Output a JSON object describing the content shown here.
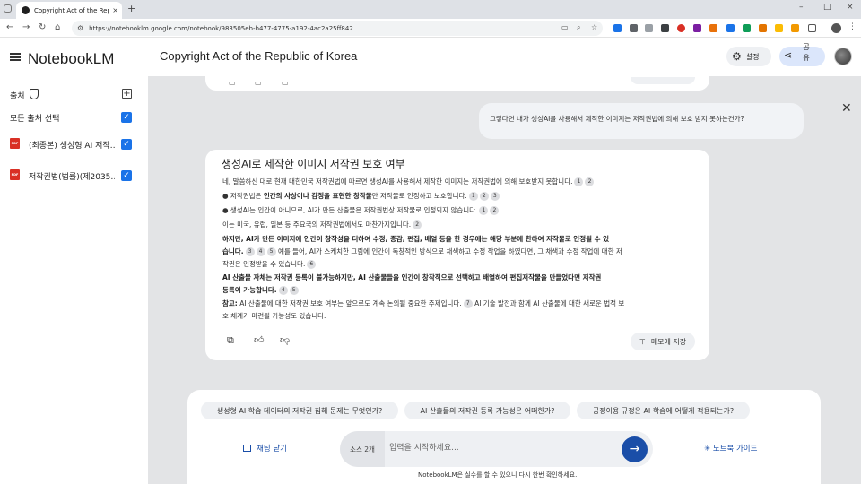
{
  "browser": {
    "tab_title": "Copyright Act of the Republic",
    "tab_close": "×",
    "new_tab": "+",
    "url": "https://notebooklm.google.com/notebook/983505eb-b477-4775-a192-4ac2a25ff842",
    "window_controls": [
      "–",
      "□",
      "×"
    ]
  },
  "header": {
    "brand": "NotebookLM",
    "notebook_title": "Copyright Act of the Republic of Korea",
    "settings_label": "설정",
    "share_label": "공유"
  },
  "sidebar": {
    "sources_heading": "출처",
    "select_all_label": "모든 출처 선택",
    "sources": [
      {
        "label": "(최종본) 생성형 AI 저작…",
        "type_badge": "PDF",
        "checked": true
      },
      {
        "label": "저작권법(법률)(제2035…",
        "type_badge": "PDF",
        "checked": true
      }
    ]
  },
  "chat": {
    "user_question": "그렇다면 내가 생성AI를 사용해서 제작한 이미지는 저작권법에 의해 보호 받지 못하는건가?",
    "answer_title": "생성AI로 제작한 이미지 저작권 보호 여부",
    "answer": {
      "p1": "네, 말씀하신 대로 현재 대한민국 저작권법에 따르면 생성AI를 사용해서 제작한 이미지는 저작권법에 의해 보호받지 못합니다.",
      "b1_pre": "● 저작권법은 ",
      "b1_bold": "인간의 사상이나 감정을 표현한 창작물",
      "b1_post": "만 저작물로 인정하고 보호합니다.",
      "b2": "● 생성AI는 인간이 아니므로, AI가 만든 산출물은 저작권법상 저작물로 인정되지 않습니다.",
      "p2": "이는 미국, 유럽, 일본 등 주요국의 저작권법에서도 마찬가지입니다.",
      "p3_l1": "하지만, AI가 만든 이미지에 인간이 창작성을 더하여 수정, 증감, 편집, 배열 등을 한 경우에는 해당 부분에 한하여 저작물로 인정될 수 있",
      "p3_l2": "습니다.",
      "p3_l2_rest": "예를 들어, AI가 스케치한 그림에 인간이 독창적인 방식으로 채색하고 수정 작업을 하였다면, 그 채색과 수정 작업에 대한 저",
      "p3_l3": "작권은 인정받을 수 있습니다.",
      "p4_l1": "AI 산출물 자체는 저작권 등록이 불가능하지만, AI 산출물들을 인간이 창작적으로 선택하고 배열하여 편집저작물을 만들었다면 저작권",
      "p4_l2": "등록이 가능합니다.",
      "p5_label": "참고:",
      "p5_l1": "AI 산출물에 대한 저작권 보호 여부는 앞으로도 계속 논의될 중요한 주제입니다.",
      "p5_l1_rest": "AI 기술 발전과 함께 AI 산출물에 대한 새로운 법적 보",
      "p5_l2": "호 체계가 마련될 가능성도 있습니다."
    },
    "citations": {
      "c1": "1",
      "c2": "2",
      "c3": "3",
      "c4": "4",
      "c5": "5",
      "c6": "6",
      "c7": "7"
    },
    "save_note_label": "메모에 저장"
  },
  "composer": {
    "suggestions": [
      "생성형 AI 학습 데이터의 저작권 침해 문제는 무엇인가?",
      "AI 산출물의 저작권 등록 가능성은 어떠한가?",
      "공정이용 규정은 AI 학습에 어떻게 적용되는가?"
    ],
    "close_chat_label": "채팅 닫기",
    "source_count": "소스 2개",
    "input_placeholder": "입력을 시작하세요...",
    "guide_label": "노트북 가이드",
    "disclaimer": "NotebookLM은 실수를 할 수 있으니 다시 한번 확인하세요."
  },
  "colors": {
    "accent": "#1a73e8",
    "primary_button": "#1a4ea8",
    "chat_background": "#e3e4e6"
  }
}
